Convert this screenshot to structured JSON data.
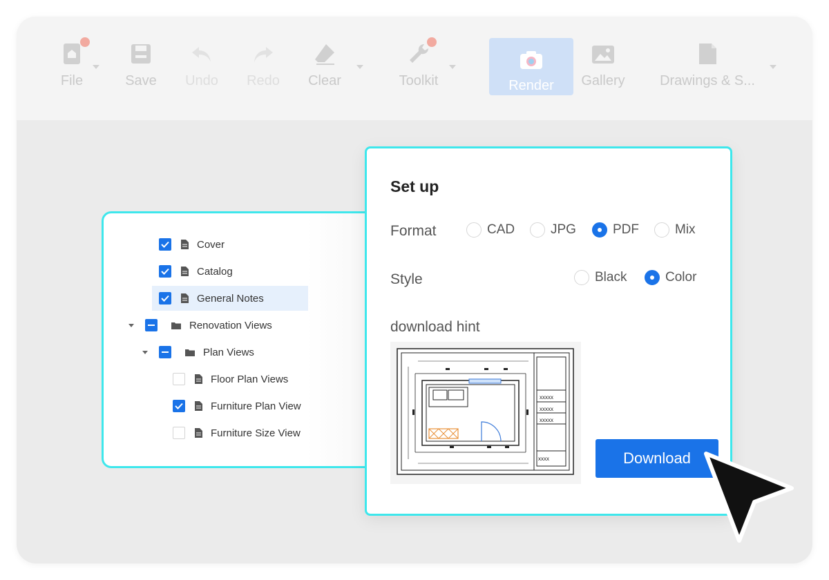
{
  "toolbar": {
    "file": "File",
    "save": "Save",
    "undo": "Undo",
    "redo": "Redo",
    "clear": "Clear",
    "toolkit": "Toolkit",
    "render": "Render",
    "gallery": "Gallery",
    "drawings": "Drawings & S..."
  },
  "tree": {
    "cover": "Cover",
    "catalog": "Catalog",
    "general_notes": "General Notes",
    "renovation_views": "Renovation Views",
    "plan_views": "Plan Views",
    "floor_plan_views": "Floor Plan Views",
    "furniture_plan_view": "Furniture Plan View",
    "furniture_size_view": "Furniture Size View"
  },
  "setup": {
    "title": "Set up",
    "format_label": "Format",
    "format_options": [
      "CAD",
      "JPG",
      "PDF",
      "Mix"
    ],
    "format_selected": "PDF",
    "style_label": "Style",
    "style_options": [
      "Black",
      "Color"
    ],
    "style_selected": "Color",
    "hint_label": "download hint",
    "preview_table": [
      "xxxxx",
      "xxxxx",
      "xxxxx",
      "xxxx"
    ],
    "download_label": "Download"
  },
  "colors": {
    "accent": "#1a73e8",
    "panel_border": "#3ee7ec",
    "notification_dot": "#f2aaa0"
  }
}
